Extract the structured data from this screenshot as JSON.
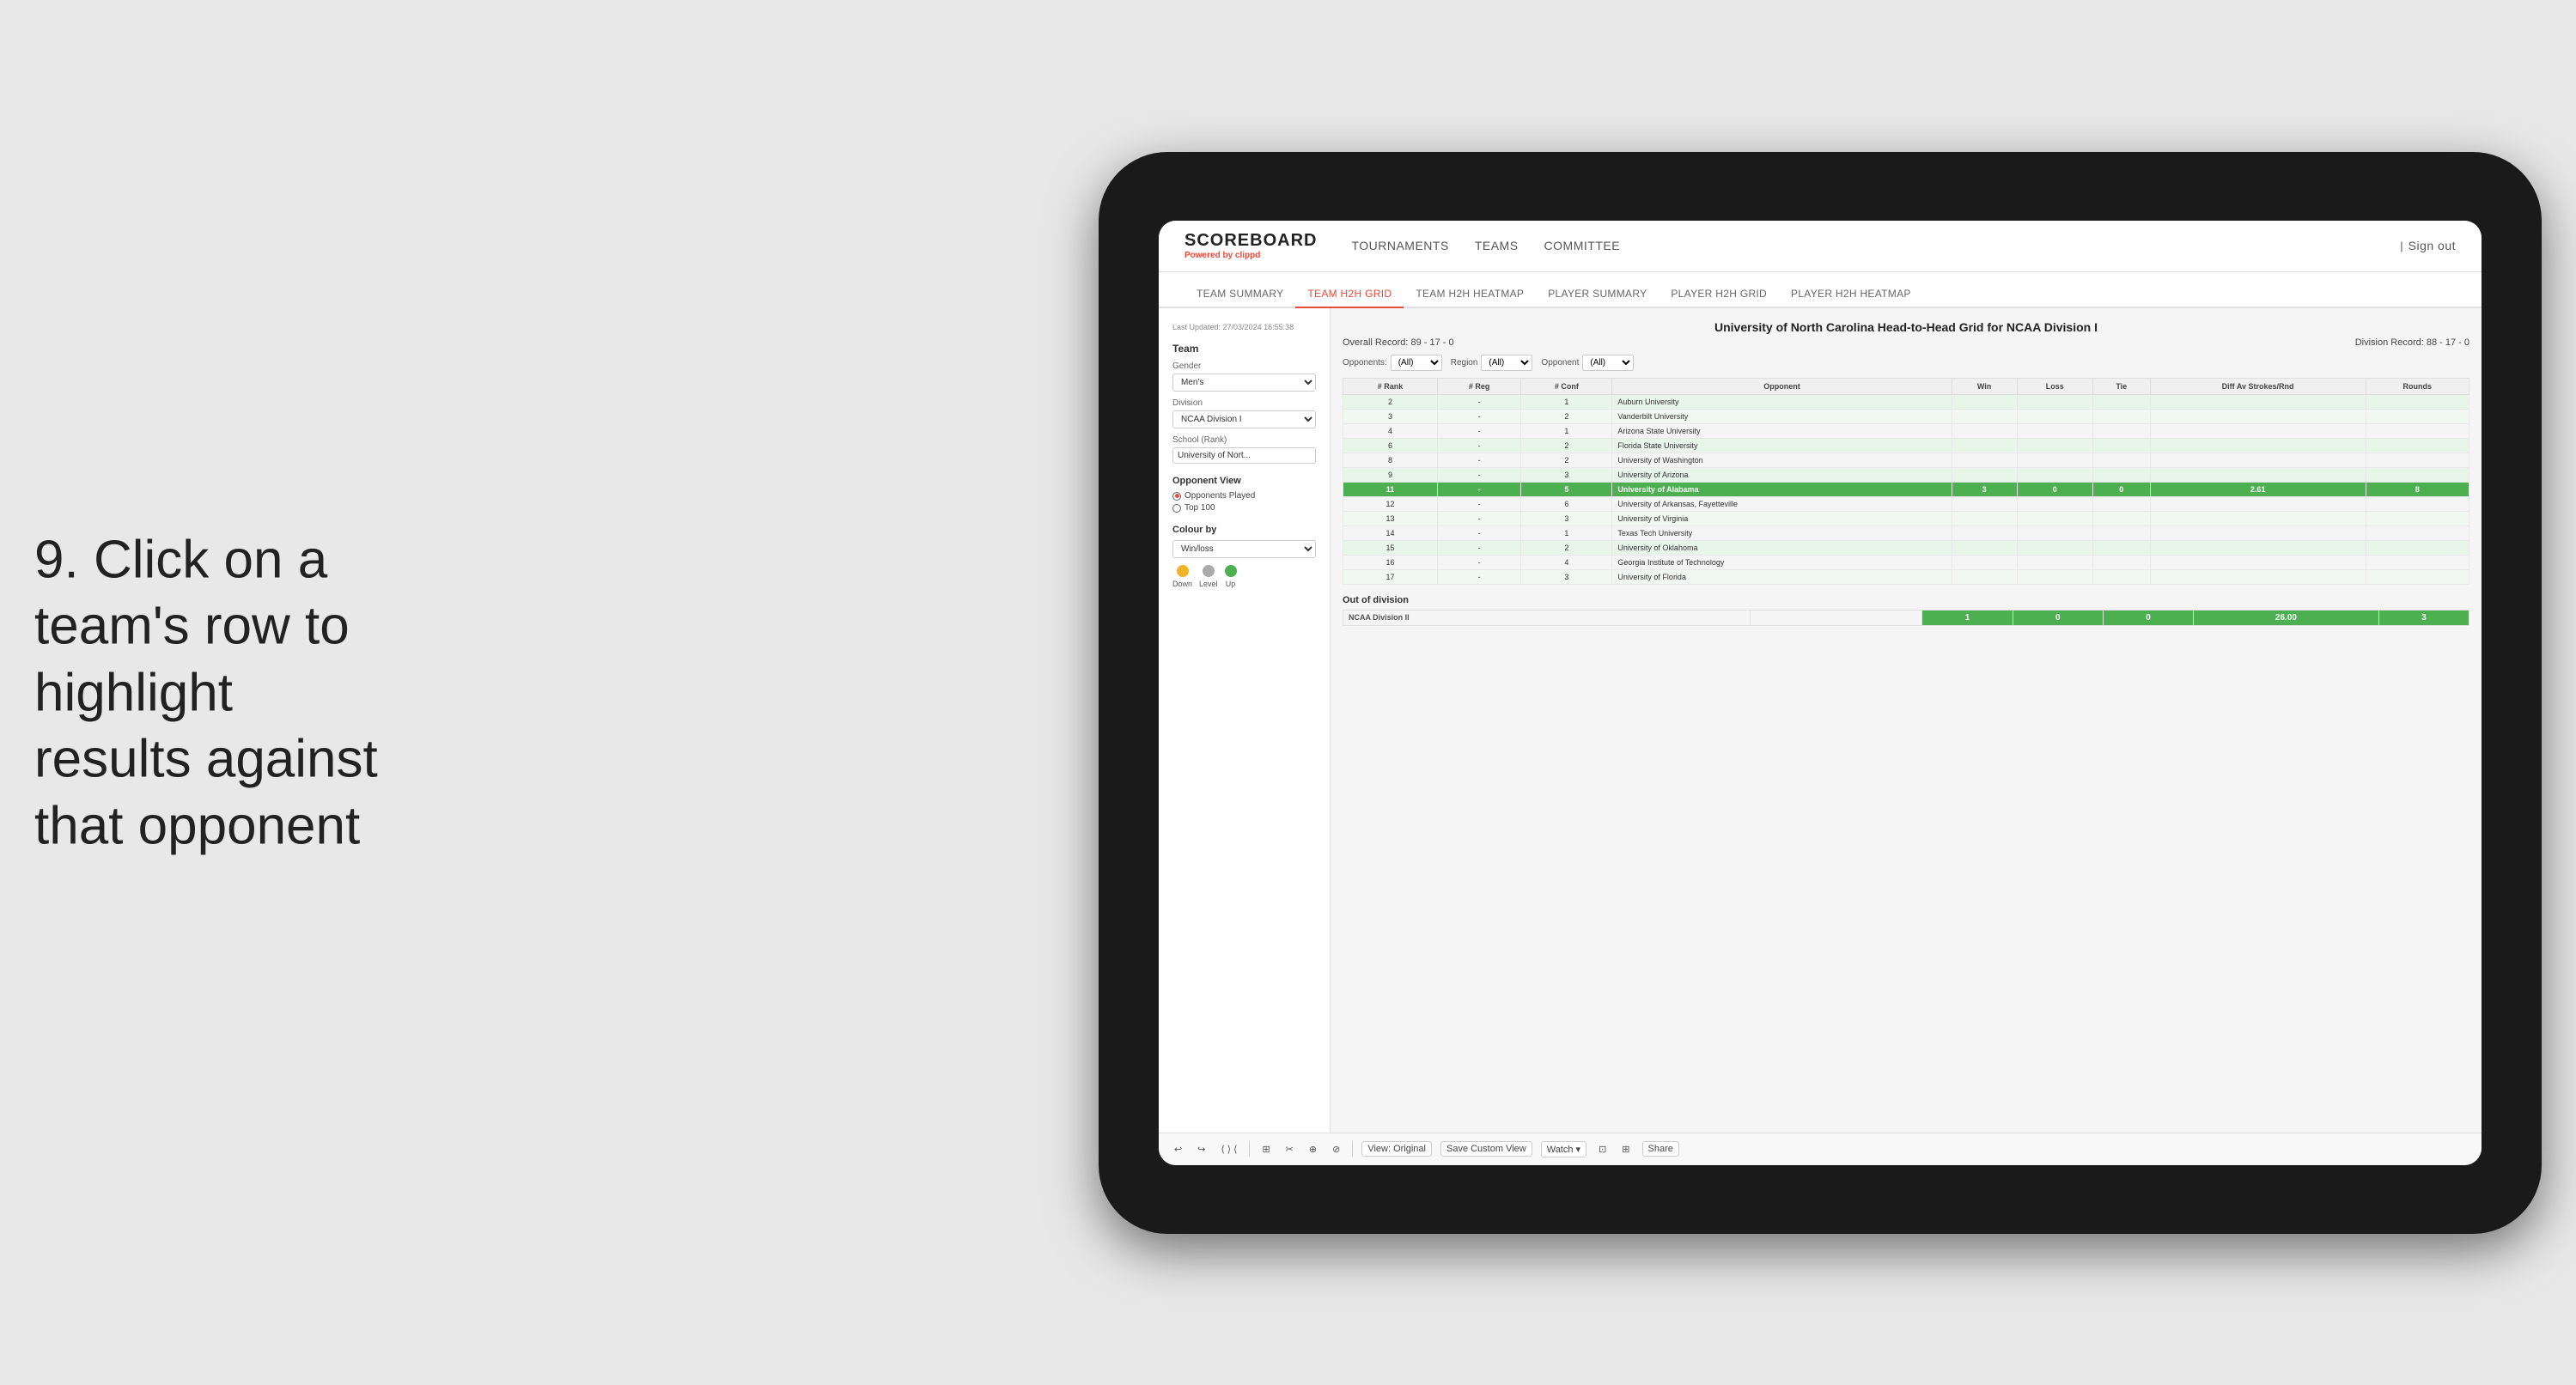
{
  "instruction": {
    "step": "9.",
    "text": "Click on a team's row to highlight results against that opponent"
  },
  "nav": {
    "logo": "SCOREBOARD",
    "powered_by": "Powered by",
    "brand": "clippd",
    "items": [
      "TOURNAMENTS",
      "TEAMS",
      "COMMITTEE"
    ],
    "sign_out": "Sign out"
  },
  "sub_tabs": [
    {
      "label": "TEAM SUMMARY",
      "active": false
    },
    {
      "label": "TEAM H2H GRID",
      "active": true
    },
    {
      "label": "TEAM H2H HEATMAP",
      "active": false
    },
    {
      "label": "PLAYER SUMMARY",
      "active": false
    },
    {
      "label": "PLAYER H2H GRID",
      "active": false
    },
    {
      "label": "PLAYER H2H HEATMAP",
      "active": false
    }
  ],
  "sidebar": {
    "last_updated": "Last Updated: 27/03/2024\n16:55:38",
    "team_title": "Team",
    "gender_label": "Gender",
    "gender_value": "Men's",
    "division_label": "Division",
    "division_value": "NCAA Division I",
    "school_label": "School (Rank)",
    "school_value": "University of Nort...",
    "opponent_view_title": "Opponent View",
    "opponents_played": "Opponents Played",
    "top_100": "Top 100",
    "colour_by_title": "Colour by",
    "colour_by_value": "Win/loss",
    "legend": [
      {
        "label": "Down",
        "color": "#f0b429"
      },
      {
        "label": "Level",
        "color": "#aaa"
      },
      {
        "label": "Up",
        "color": "#4CAF50"
      }
    ]
  },
  "grid": {
    "title": "University of North Carolina Head-to-Head Grid for NCAA Division I",
    "overall_record": "Overall Record: 89 - 17 - 0",
    "division_record": "Division Record: 88 - 17 - 0",
    "filter_opponents_label": "Opponents:",
    "filter_opponents_value": "(All)",
    "filter_region_label": "Region",
    "filter_region_value": "(All)",
    "filter_opponent_label": "Opponent",
    "filter_opponent_value": "(All)",
    "columns": [
      "# Rank",
      "# Reg",
      "# Conf",
      "Opponent",
      "Win",
      "Loss",
      "Tie",
      "Diff Av Strokes/Rnd",
      "Rounds"
    ],
    "rows": [
      {
        "rank": "2",
        "reg": "-",
        "conf": "1",
        "opponent": "Auburn University",
        "win": "",
        "loss": "",
        "tie": "",
        "diff": "",
        "rounds": "",
        "row_class": "light-green"
      },
      {
        "rank": "3",
        "reg": "-",
        "conf": "2",
        "opponent": "Vanderbilt University",
        "win": "",
        "loss": "",
        "tie": "",
        "diff": "",
        "rounds": "",
        "row_class": "lighter-green"
      },
      {
        "rank": "4",
        "reg": "-",
        "conf": "1",
        "opponent": "Arizona State University",
        "win": "",
        "loss": "",
        "tie": "",
        "diff": "",
        "rounds": "",
        "row_class": ""
      },
      {
        "rank": "6",
        "reg": "-",
        "conf": "2",
        "opponent": "Florida State University",
        "win": "",
        "loss": "",
        "tie": "",
        "diff": "",
        "rounds": "",
        "row_class": "light-green"
      },
      {
        "rank": "8",
        "reg": "-",
        "conf": "2",
        "opponent": "University of Washington",
        "win": "",
        "loss": "",
        "tie": "",
        "diff": "",
        "rounds": "",
        "row_class": ""
      },
      {
        "rank": "9",
        "reg": "-",
        "conf": "3",
        "opponent": "University of Arizona",
        "win": "",
        "loss": "",
        "tie": "",
        "diff": "",
        "rounds": "",
        "row_class": "light-green"
      },
      {
        "rank": "11",
        "reg": "-",
        "conf": "5",
        "opponent": "University of Alabama",
        "win": "3",
        "loss": "0",
        "tie": "0",
        "diff": "2.61",
        "rounds": "8",
        "row_class": "highlighted-row"
      },
      {
        "rank": "12",
        "reg": "-",
        "conf": "6",
        "opponent": "University of Arkansas, Fayetteville",
        "win": "",
        "loss": "",
        "tie": "",
        "diff": "",
        "rounds": "",
        "row_class": ""
      },
      {
        "rank": "13",
        "reg": "-",
        "conf": "3",
        "opponent": "University of Virginia",
        "win": "",
        "loss": "",
        "tie": "",
        "diff": "",
        "rounds": "",
        "row_class": "lighter-green"
      },
      {
        "rank": "14",
        "reg": "-",
        "conf": "1",
        "opponent": "Texas Tech University",
        "win": "",
        "loss": "",
        "tie": "",
        "diff": "",
        "rounds": "",
        "row_class": ""
      },
      {
        "rank": "15",
        "reg": "-",
        "conf": "2",
        "opponent": "University of Oklahoma",
        "win": "",
        "loss": "",
        "tie": "",
        "diff": "",
        "rounds": "",
        "row_class": "light-green"
      },
      {
        "rank": "16",
        "reg": "-",
        "conf": "4",
        "opponent": "Georgia Institute of Technology",
        "win": "",
        "loss": "",
        "tie": "",
        "diff": "",
        "rounds": "",
        "row_class": ""
      },
      {
        "rank": "17",
        "reg": "-",
        "conf": "3",
        "opponent": "University of Florida",
        "win": "",
        "loss": "",
        "tie": "",
        "diff": "",
        "rounds": "",
        "row_class": "lighter-green"
      }
    ],
    "out_of_division_title": "Out of division",
    "out_division_row": {
      "label": "NCAA Division II",
      "win": "1",
      "loss": "0",
      "tie": "0",
      "diff": "26.00",
      "rounds": "3"
    }
  },
  "toolbar": {
    "undo": "↩",
    "redo": "↪",
    "history_back": "‹",
    "view_original": "View: Original",
    "save_custom": "Save Custom View",
    "watch": "Watch ▾",
    "share": "Share"
  }
}
